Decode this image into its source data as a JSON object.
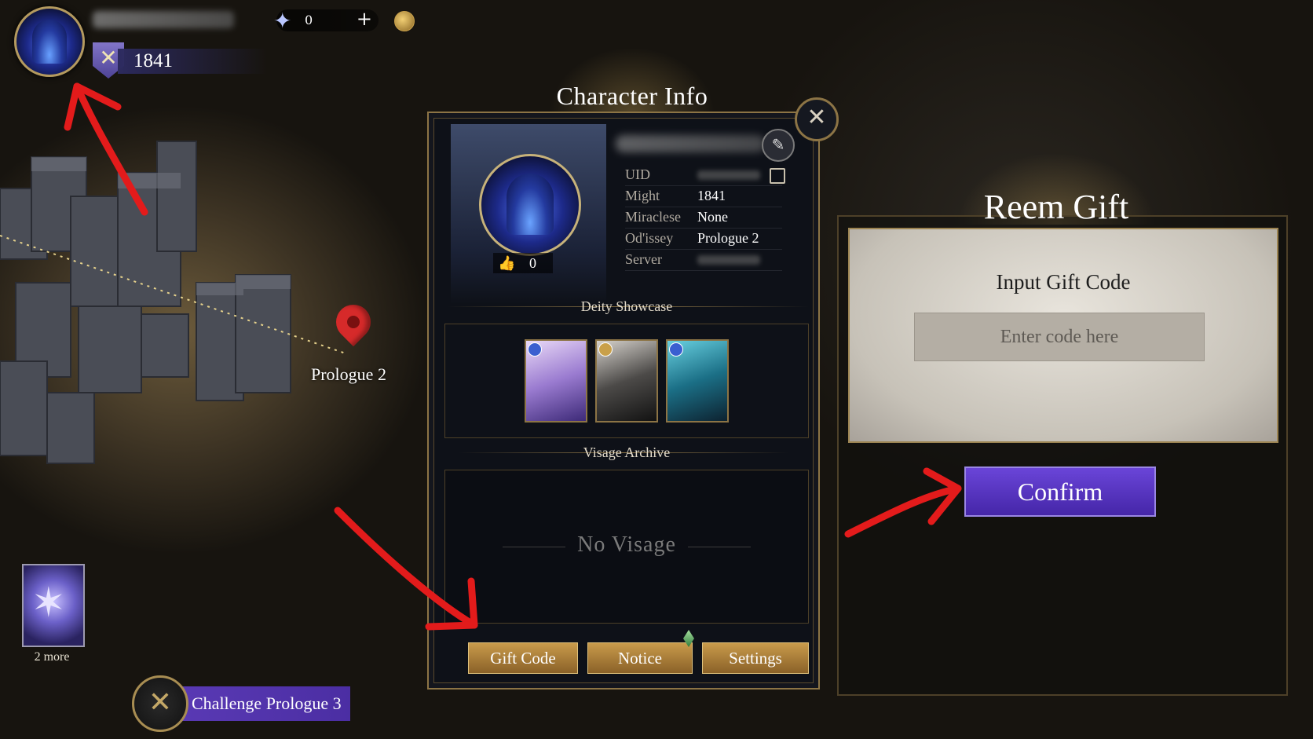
{
  "hud": {
    "might": "1841",
    "gems": "0",
    "plus": "+"
  },
  "map": {
    "marker_label": "Prologue 2",
    "more_label": "2 more",
    "challenge_label": "Challenge Prologue 3"
  },
  "character_info": {
    "title": "Character Info",
    "likes": "0",
    "fields": [
      {
        "key": "UID",
        "value": ""
      },
      {
        "key": "Might",
        "value": "1841"
      },
      {
        "key": "Miraclese",
        "value": "None"
      },
      {
        "key": "Od'issey",
        "value": "Prologue 2"
      },
      {
        "key": "Server",
        "value": ""
      }
    ],
    "deity_showcase_title": "Deity Showcase",
    "visage_archive_title": "Visage Archive",
    "no_visage": "No Visage",
    "buttons": {
      "gift_code": "Gift Code",
      "notice": "Notice",
      "settings": "Settings"
    }
  },
  "redeem_gift": {
    "title": "Reem Gift",
    "input_label": "Input Gift Code",
    "input_placeholder": "Enter code here",
    "confirm": "Confirm"
  },
  "colors": {
    "accent_gold": "#c99b4b",
    "accent_purple": "#5a3ab5",
    "arrow_red": "#e31b1b"
  }
}
